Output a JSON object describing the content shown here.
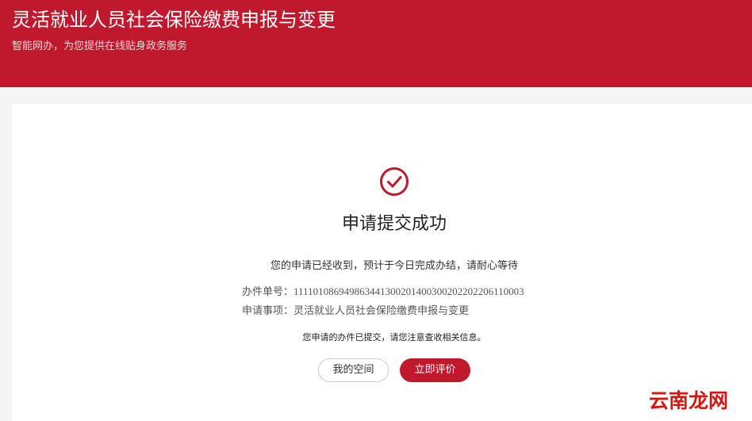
{
  "header": {
    "title": "灵活就业人员社会保险缴费申报与变更",
    "subtitle": "智能网办，为您提供在线贴身政务服务"
  },
  "result": {
    "icon": "check-circle-icon",
    "title": "申请提交成功",
    "notice": "您的申请已经收到，预计于今日完成办结，请耐心等待",
    "serial_label": "办件单号：",
    "serial_value": "11110108694986344130020140030020220220611000 3",
    "matter_label": "申请事项：",
    "matter_value": "灵活就业人员社会保险缴费申报与变更",
    "tip": "您申请的办件已提交，请您注意查收相关信息。"
  },
  "actions": {
    "my_space_label": "我的空间",
    "evaluate_label": "立即评价"
  },
  "watermark": {
    "text": "云南龙网"
  },
  "colors": {
    "brand": "#c0192d",
    "page_background": "#f5f5f5"
  }
}
